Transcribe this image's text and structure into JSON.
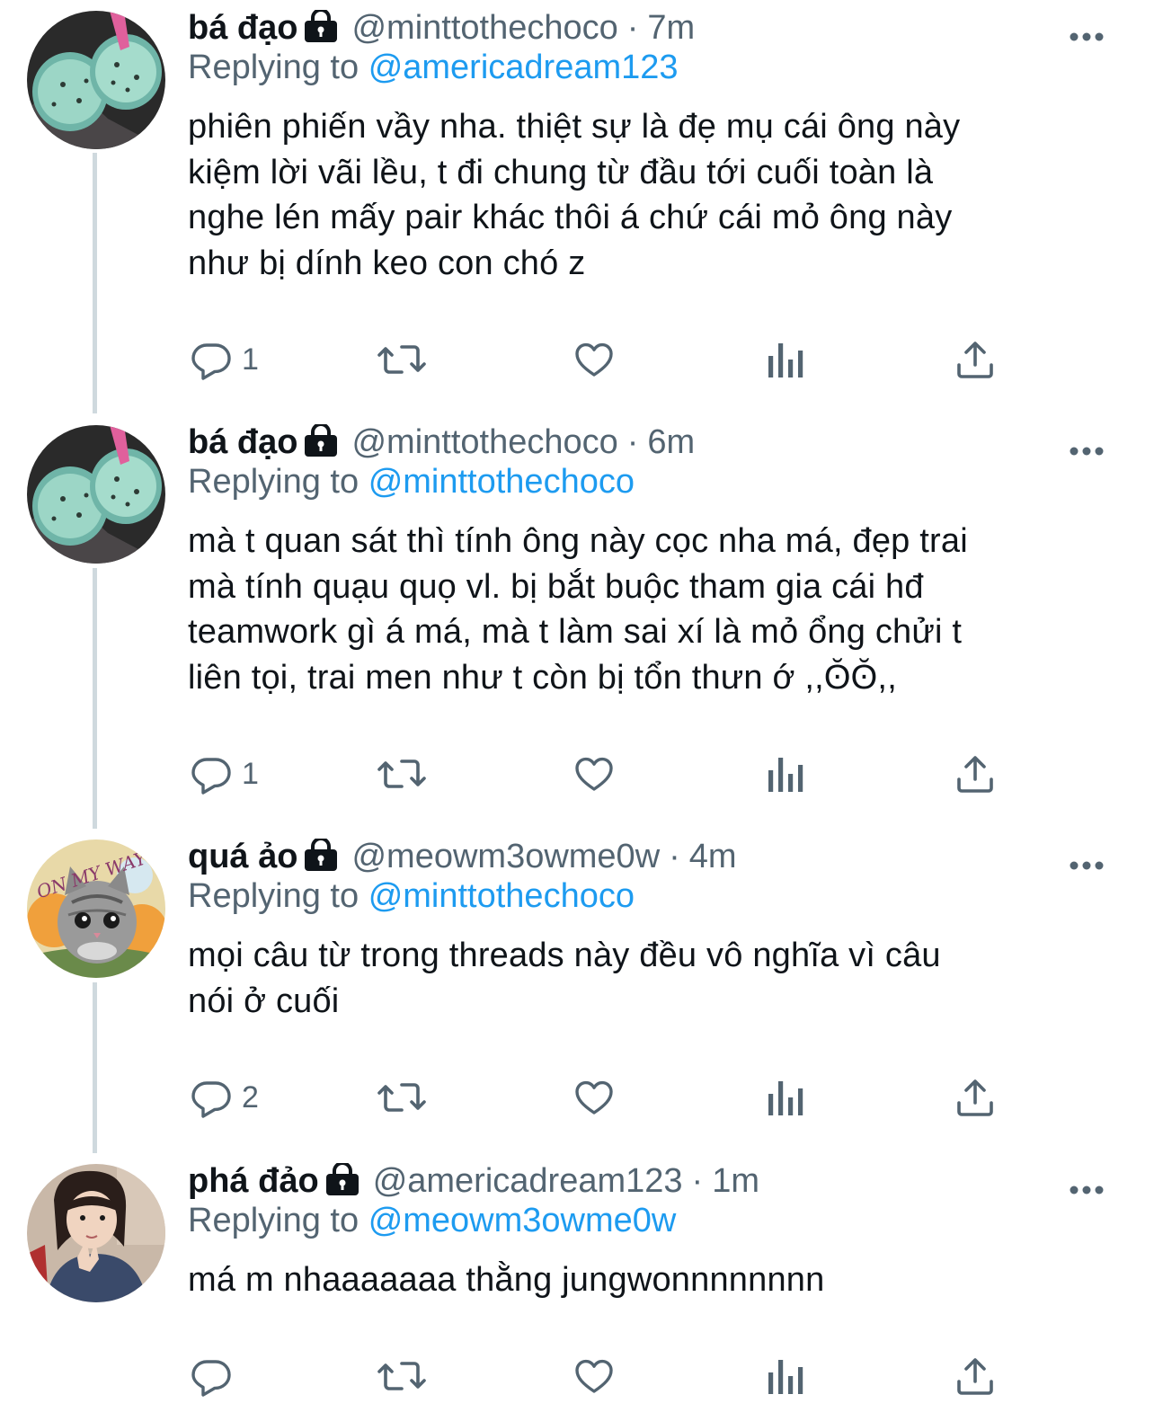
{
  "tweets": [
    {
      "name": "bá đạo",
      "handle": "@minttothechoco",
      "sep": "·",
      "time": "7m",
      "replying_prefix": "Replying to",
      "replying_to": "@americadream123",
      "text": "phiên phiến vầy nha. thiệt sự là đẹ mụ cái ông này\nkiệm lời vãi lều, t đi chung từ đầu tới cuối toàn là\nnghe lén mấy pair khác thôi á chứ cái mỏ ông này\nnhư bị dính keo con chó z",
      "reply_count": "1",
      "avatar": "mint-ice-cream-cups"
    },
    {
      "name": "bá đạo",
      "handle": "@minttothechoco",
      "sep": "·",
      "time": "6m",
      "replying_prefix": "Replying to",
      "replying_to": "@minttothechoco",
      "text": "mà t quan sát thì tính ông này cọc nha má, đẹp trai\nmà tính quạu quọ vl. bị bắt buộc tham gia cái hđ\nteamwork gì á má, mà t làm sai xí là mỏ ổng chửi t\nliên tọi, trai men như t còn bị tổn thưn ớ ,,ʘ̆ʘ̆,,",
      "reply_count": "1",
      "avatar": "mint-ice-cream-cups"
    },
    {
      "name": "quá ảo",
      "handle": "@meowm3owme0w",
      "sep": "·",
      "time": "4m",
      "replying_prefix": "Replying to",
      "replying_to": "@minttothechoco",
      "text": "mọi câu từ trong threads này đều vô nghĩa vì câu\nnói ở cuối",
      "reply_count": "2",
      "avatar": "kitten-on-my-way",
      "avatar_text": "ON MY WAY"
    },
    {
      "name": "phá đảo",
      "handle": "@americadream123",
      "sep": "·",
      "time": "1m",
      "replying_prefix": "Replying to",
      "replying_to": "@meowm3owme0w",
      "text": "má m nhaaaaaaa thằng jungwonnnnnnnn",
      "reply_count": "",
      "avatar": "person-selfie"
    }
  ],
  "colors": {
    "text": "#0f1419",
    "secondary": "#536471",
    "link": "#1d9bf0",
    "thread_line": "#cfd9de"
  },
  "icons": [
    "lock-icon",
    "more-icon",
    "reply-icon",
    "retweet-icon",
    "like-icon",
    "views-icon",
    "share-icon"
  ]
}
